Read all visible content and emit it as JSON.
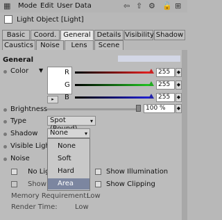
{
  "menubar": {
    "items": [
      "Mode",
      "Edit",
      "User Data"
    ]
  },
  "title": "Light Object [Light]",
  "tabs_row1": [
    "Basic",
    "Coord.",
    "General",
    "Details",
    "Visibility",
    "Shadow"
  ],
  "tabs_row2": [
    "Caustics",
    "Noise",
    "Lens",
    "Scene"
  ],
  "active_tab": "General",
  "section": "General",
  "color": {
    "label": "Color",
    "r_label": "R",
    "g_label": "G",
    "b_label": "B",
    "r": "255",
    "g": "255",
    "b": "255"
  },
  "brightness": {
    "label": "Brightness",
    "value": "100 %"
  },
  "type": {
    "label": "Type",
    "value": "Spot (Round)"
  },
  "shadow": {
    "label": "Shadow",
    "value": "None"
  },
  "visible_light": {
    "label": "Visible Light"
  },
  "noise": {
    "label": "Noise"
  },
  "shadow_options": [
    "None",
    "Soft",
    "Hard",
    "Area"
  ],
  "selected_shadow_option": "Area",
  "checks": {
    "no_light": "No Ligh",
    "show_v": "Show V",
    "show_illumination": "Show Illumination",
    "show_clipping": "Show Clipping"
  },
  "memory": {
    "label": "Memory Requirement:",
    "value": "Low"
  },
  "render_time": {
    "label": "Render Time:",
    "value": "Low"
  },
  "colors": {
    "accent_selection": "#7c86a0",
    "slider_red": "#c22",
    "slider_green": "#2a2",
    "slider_blue": "#22a"
  }
}
